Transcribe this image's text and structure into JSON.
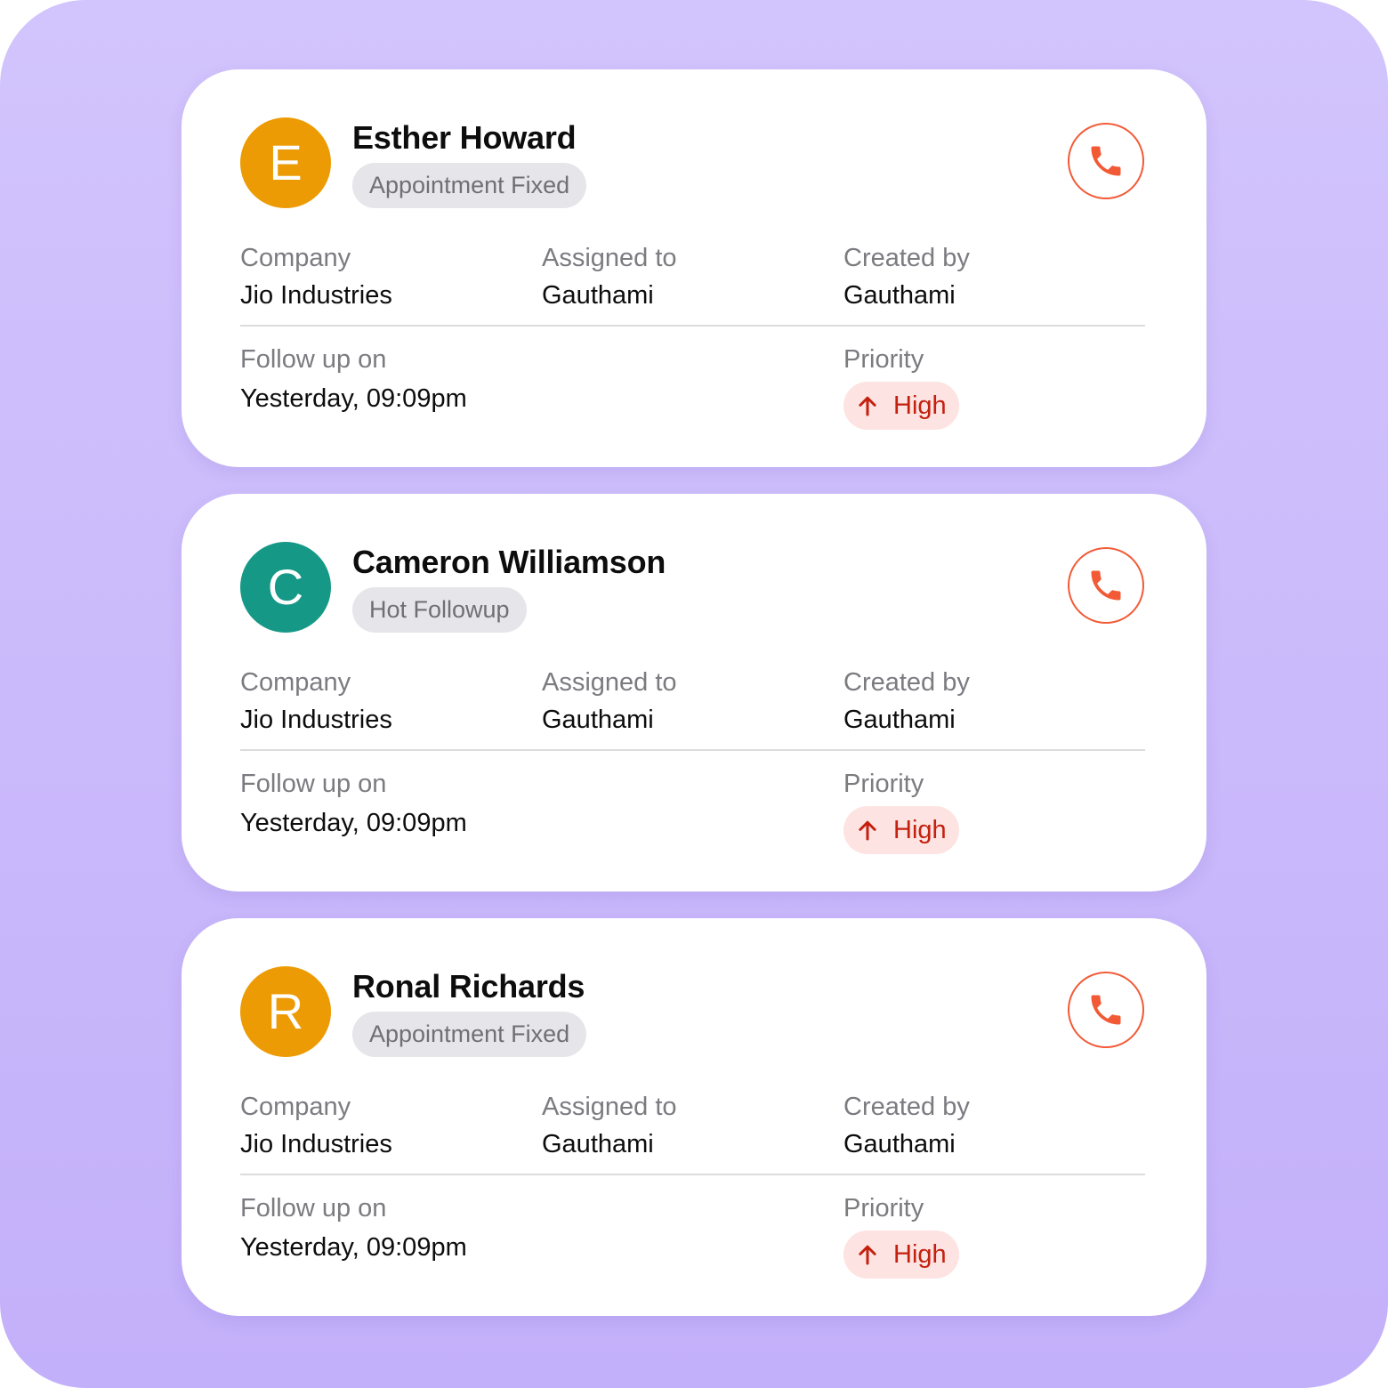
{
  "colors": {
    "background_top": "#d2c4fc",
    "background_bottom": "#c3b0fa",
    "card": "#ffffff",
    "accent_call": "#f25a36",
    "priority_bg": "#fde3e1",
    "priority_text": "#c4200f",
    "chip_bg": "#e6e6ea"
  },
  "leads": [
    {
      "initial": "E",
      "avatar_color": "#ec9b04",
      "name": "Esther Howard",
      "status": "Appointment Fixed",
      "company_label": "Company",
      "company": "Jio Industries",
      "assigned_label": "Assigned to",
      "assigned": "Gauthami",
      "created_label": "Created by",
      "created": "Gauthami",
      "followup_label": "Follow up on",
      "followup": "Yesterday, 09:09pm",
      "priority_label": "Priority",
      "priority": "High",
      "call_icon": "phone-icon",
      "priority_icon": "arrow-up-icon"
    },
    {
      "initial": "C",
      "avatar_color": "#169887",
      "name": "Cameron Williamson",
      "status": "Hot Followup",
      "company_label": "Company",
      "company": "Jio Industries",
      "assigned_label": "Assigned to",
      "assigned": "Gauthami",
      "created_label": "Created by",
      "created": "Gauthami",
      "followup_label": "Follow up on",
      "followup": "Yesterday, 09:09pm",
      "priority_label": "Priority",
      "priority": "High",
      "call_icon": "phone-icon",
      "priority_icon": "arrow-up-icon"
    },
    {
      "initial": "R",
      "avatar_color": "#ec9b04",
      "name": "Ronal Richards",
      "status": "Appointment Fixed",
      "company_label": "Company",
      "company": "Jio Industries",
      "assigned_label": "Assigned to",
      "assigned": "Gauthami",
      "created_label": "Created by",
      "created": "Gauthami",
      "followup_label": "Follow up on",
      "followup": "Yesterday, 09:09pm",
      "priority_label": "Priority",
      "priority": "High",
      "call_icon": "phone-icon",
      "priority_icon": "arrow-up-icon"
    }
  ]
}
